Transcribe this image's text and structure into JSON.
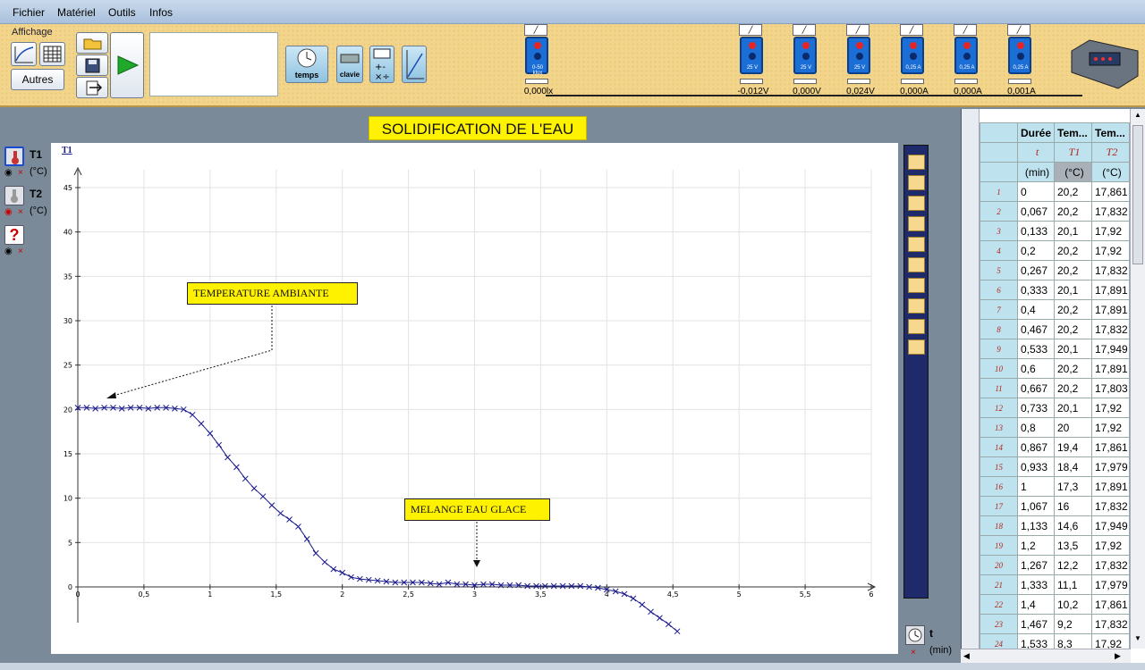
{
  "menu": [
    "Fichier",
    "Matériel",
    "Outils",
    "Infos"
  ],
  "toolbar": {
    "affichage_label": "Affichage",
    "autres_label": "Autres",
    "temps_label": "temps",
    "clavier_label": "clavie"
  },
  "sensors": [
    {
      "id": "lux",
      "range": "0-50\nklux",
      "value": "0,000lx",
      "color": "#1b6ed6"
    },
    {
      "id": "v1",
      "range": "25 V",
      "value": "-0,012V",
      "color": "#1b6ed6"
    },
    {
      "id": "v2",
      "range": "25 V",
      "value": "0,000V",
      "color": "#1b6ed6"
    },
    {
      "id": "v3",
      "range": "25 V",
      "value": "0,024V",
      "color": "#1b6ed6"
    },
    {
      "id": "a1",
      "range": "0,25 A",
      "value": "0,000A",
      "color": "#1b6ed6"
    },
    {
      "id": "a2",
      "range": "0,25 A",
      "value": "0,000A",
      "color": "#1b6ed6"
    },
    {
      "id": "a3",
      "range": "0,25 A",
      "value": "0,001A",
      "color": "#1b6ed6"
    }
  ],
  "curves": [
    {
      "name": "T1",
      "unit": "(°C)"
    },
    {
      "name": "T2",
      "unit": "(°C)"
    }
  ],
  "x_axis": {
    "name": "t",
    "unit": "(min)"
  },
  "annotations": {
    "ambient": "TEMPERATURE AMBIANTE",
    "mix": "MELANGE EAU GLACE"
  },
  "chart_data": {
    "type": "line",
    "title": "SOLIDIFICATION DE L'EAU",
    "series_label": "T1",
    "xlim": [
      0,
      6
    ],
    "ylim": [
      0,
      45
    ],
    "xticks": [
      "0",
      "0,5",
      "1",
      "1,5",
      "2",
      "2,5",
      "3",
      "3,5",
      "4",
      "4,5",
      "5",
      "5,5",
      "6"
    ],
    "yticks": [
      "0",
      "5",
      "10",
      "15",
      "20",
      "25",
      "30",
      "35",
      "40",
      "45"
    ],
    "grid": true,
    "color": "#1a1a8c",
    "series": [
      {
        "name": "T1",
        "x": [
          0,
          0.067,
          0.133,
          0.2,
          0.267,
          0.333,
          0.4,
          0.467,
          0.533,
          0.6,
          0.667,
          0.733,
          0.8,
          0.867,
          0.933,
          1,
          1.067,
          1.133,
          1.2,
          1.267,
          1.333,
          1.4,
          1.467,
          1.533,
          1.6,
          1.667,
          1.733,
          1.8,
          1.867,
          1.933,
          2,
          2.067,
          2.133,
          2.2,
          2.267,
          2.333,
          2.4,
          2.467,
          2.533,
          2.6,
          2.667,
          2.733,
          2.8,
          2.867,
          2.933,
          3,
          3.067,
          3.133,
          3.2,
          3.267,
          3.333,
          3.4,
          3.467,
          3.533,
          3.6,
          3.667,
          3.733,
          3.8,
          3.867,
          3.933,
          4,
          4.067,
          4.133,
          4.2,
          4.267,
          4.333,
          4.4,
          4.467,
          4.533
        ],
        "y": [
          20.2,
          20.2,
          20.1,
          20.2,
          20.2,
          20.1,
          20.2,
          20.2,
          20.1,
          20.2,
          20.2,
          20.1,
          20,
          19.4,
          18.4,
          17.3,
          16,
          14.6,
          13.5,
          12.2,
          11.1,
          10.2,
          9.2,
          8.3,
          7.6,
          6.8,
          5.4,
          3.8,
          2.8,
          2.0,
          1.6,
          1.1,
          0.9,
          0.8,
          0.7,
          0.6,
          0.5,
          0.5,
          0.5,
          0.5,
          0.4,
          0.3,
          0.5,
          0.3,
          0.3,
          0.2,
          0.3,
          0.3,
          0.2,
          0.2,
          0.2,
          0.1,
          0.1,
          0.1,
          0.1,
          0.1,
          0.1,
          0.1,
          0.0,
          -0.1,
          -0.3,
          -0.5,
          -0.8,
          -1.3,
          -2.0,
          -2.8,
          -3.5,
          -4.2,
          -5.0
        ]
      }
    ]
  },
  "table": {
    "headers": [
      "Durée",
      "Tem...",
      "Tem..."
    ],
    "symbols": [
      "t",
      "T1",
      "T2"
    ],
    "units": [
      "(min)",
      "(°C)",
      "(°C)"
    ],
    "rows": [
      [
        "1",
        "0",
        "20,2",
        "17,861"
      ],
      [
        "2",
        "0,067",
        "20,2",
        "17,832"
      ],
      [
        "3",
        "0,133",
        "20,1",
        "17,92"
      ],
      [
        "4",
        "0,2",
        "20,2",
        "17,92"
      ],
      [
        "5",
        "0,267",
        "20,2",
        "17,832"
      ],
      [
        "6",
        "0,333",
        "20,1",
        "17,891"
      ],
      [
        "7",
        "0,4",
        "20,2",
        "17,891"
      ],
      [
        "8",
        "0,467",
        "20,2",
        "17,832"
      ],
      [
        "9",
        "0,533",
        "20,1",
        "17,949"
      ],
      [
        "10",
        "0,6",
        "20,2",
        "17,891"
      ],
      [
        "11",
        "0,667",
        "20,2",
        "17,803"
      ],
      [
        "12",
        "0,733",
        "20,1",
        "17,92"
      ],
      [
        "13",
        "0,8",
        "20",
        "17,92"
      ],
      [
        "14",
        "0,867",
        "19,4",
        "17,861"
      ],
      [
        "15",
        "0,933",
        "18,4",
        "17,979"
      ],
      [
        "16",
        "1",
        "17,3",
        "17,891"
      ],
      [
        "17",
        "1,067",
        "16",
        "17,832"
      ],
      [
        "18",
        "1,133",
        "14,6",
        "17,949"
      ],
      [
        "19",
        "1,2",
        "13,5",
        "17,92"
      ],
      [
        "20",
        "1,267",
        "12,2",
        "17,832"
      ],
      [
        "21",
        "1,333",
        "11,1",
        "17,979"
      ],
      [
        "22",
        "1,4",
        "10,2",
        "17,861"
      ],
      [
        "23",
        "1,467",
        "9,2",
        "17,832"
      ],
      [
        "24",
        "1,533",
        "8,3",
        "17,92"
      ]
    ]
  }
}
